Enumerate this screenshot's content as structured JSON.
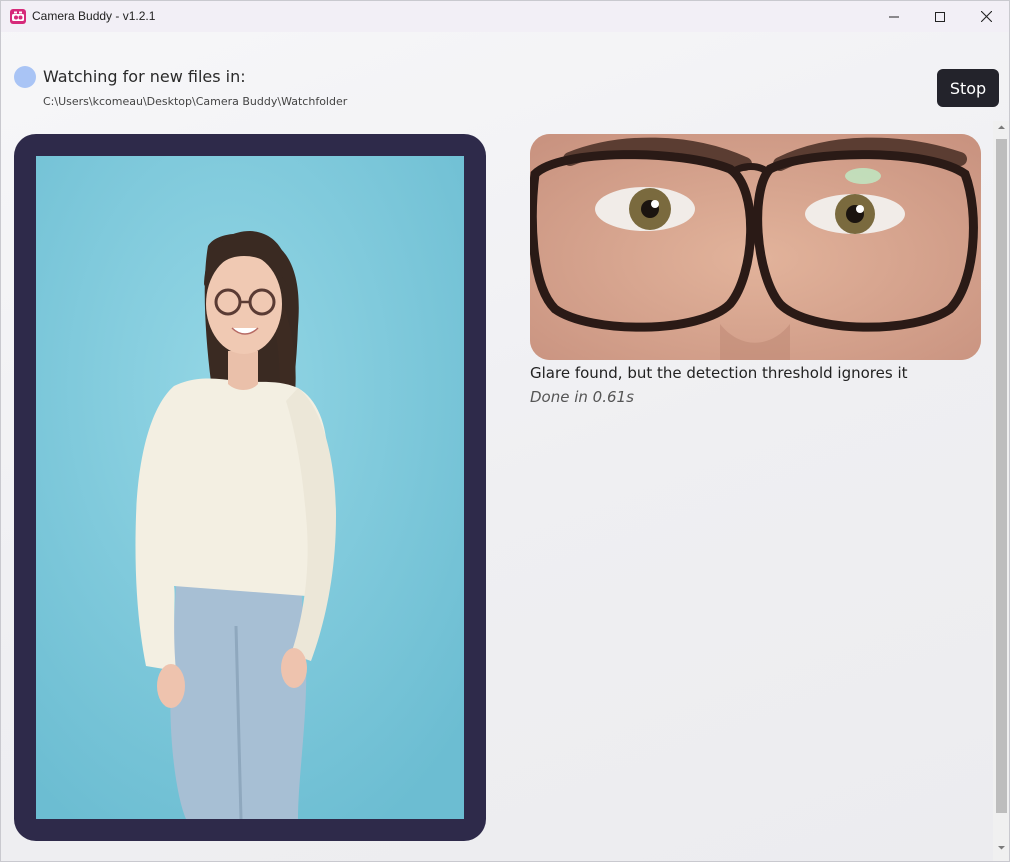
{
  "window": {
    "title": "Camera Buddy - v1.2.1"
  },
  "header": {
    "watch_label": "Watching for new files in:",
    "watch_path": "C:\\Users\\kcomeau\\Desktop\\Camera Buddy\\Watchfolder",
    "stop_label": "Stop",
    "status_color": "#a9c4f5"
  },
  "result": {
    "message": "Glare found, but the detection threshold ignores it",
    "time": "Done in 0.61s"
  },
  "colors": {
    "frame": "#2e2a4a",
    "backdrop": "#7ccadc",
    "stop_button": "#23232b"
  },
  "icons": {
    "app": "camera-buddy-app-icon",
    "minimize": "minimize-icon",
    "maximize": "maximize-icon",
    "close": "close-icon",
    "scroll_up": "scroll-up-icon",
    "scroll_down": "scroll-down-icon"
  }
}
